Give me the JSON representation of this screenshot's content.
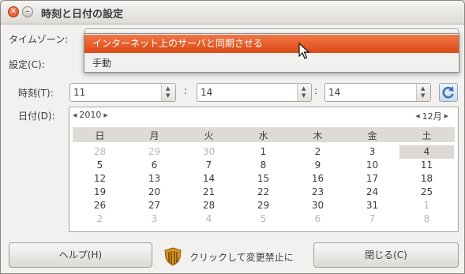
{
  "window": {
    "title": "時刻と日付の設定"
  },
  "titlebar": {
    "close_glyph": "✕",
    "minimize_glyph": "–"
  },
  "timezone": {
    "label": "タイムゾーン:"
  },
  "settings": {
    "label": "設定(C):"
  },
  "menu": {
    "items": [
      "インターネット上のサーバと同期させる",
      "手動"
    ],
    "highlighted_index": 0
  },
  "time": {
    "label": "時刻(T):",
    "hour": "11",
    "minute": "14",
    "second": "14",
    "separator": ":"
  },
  "date": {
    "label": "日付(D):"
  },
  "calendar": {
    "year": "2010",
    "month": "12月",
    "weekdays": [
      "日",
      "月",
      "火",
      "水",
      "木",
      "金",
      "土"
    ],
    "weeks": [
      [
        {
          "d": "28",
          "o": true
        },
        {
          "d": "29",
          "o": true
        },
        {
          "d": "30",
          "o": true
        },
        {
          "d": "1"
        },
        {
          "d": "2"
        },
        {
          "d": "3"
        },
        {
          "d": "4",
          "sel": true
        }
      ],
      [
        {
          "d": "5"
        },
        {
          "d": "6"
        },
        {
          "d": "7"
        },
        {
          "d": "8"
        },
        {
          "d": "9"
        },
        {
          "d": "10"
        },
        {
          "d": "11"
        }
      ],
      [
        {
          "d": "12"
        },
        {
          "d": "13"
        },
        {
          "d": "14"
        },
        {
          "d": "15"
        },
        {
          "d": "16"
        },
        {
          "d": "17"
        },
        {
          "d": "18"
        }
      ],
      [
        {
          "d": "19"
        },
        {
          "d": "20"
        },
        {
          "d": "21"
        },
        {
          "d": "22"
        },
        {
          "d": "23"
        },
        {
          "d": "24"
        },
        {
          "d": "25"
        }
      ],
      [
        {
          "d": "26"
        },
        {
          "d": "27"
        },
        {
          "d": "28"
        },
        {
          "d": "29"
        },
        {
          "d": "30"
        },
        {
          "d": "31"
        },
        {
          "d": "1",
          "o": true
        }
      ],
      [
        {
          "d": "2",
          "o": true
        },
        {
          "d": "3",
          "o": true
        },
        {
          "d": "4",
          "o": true
        },
        {
          "d": "5",
          "o": true
        },
        {
          "d": "6",
          "o": true
        },
        {
          "d": "7",
          "o": true
        },
        {
          "d": "8",
          "o": true
        }
      ]
    ]
  },
  "footer": {
    "help_label": "ヘルプ(H)",
    "lock_label": "クリックして変更禁止に",
    "close_label": "閉じる(C)"
  },
  "colors": {
    "accent": "#dd4814",
    "window_bg": "#f2f1f0"
  }
}
